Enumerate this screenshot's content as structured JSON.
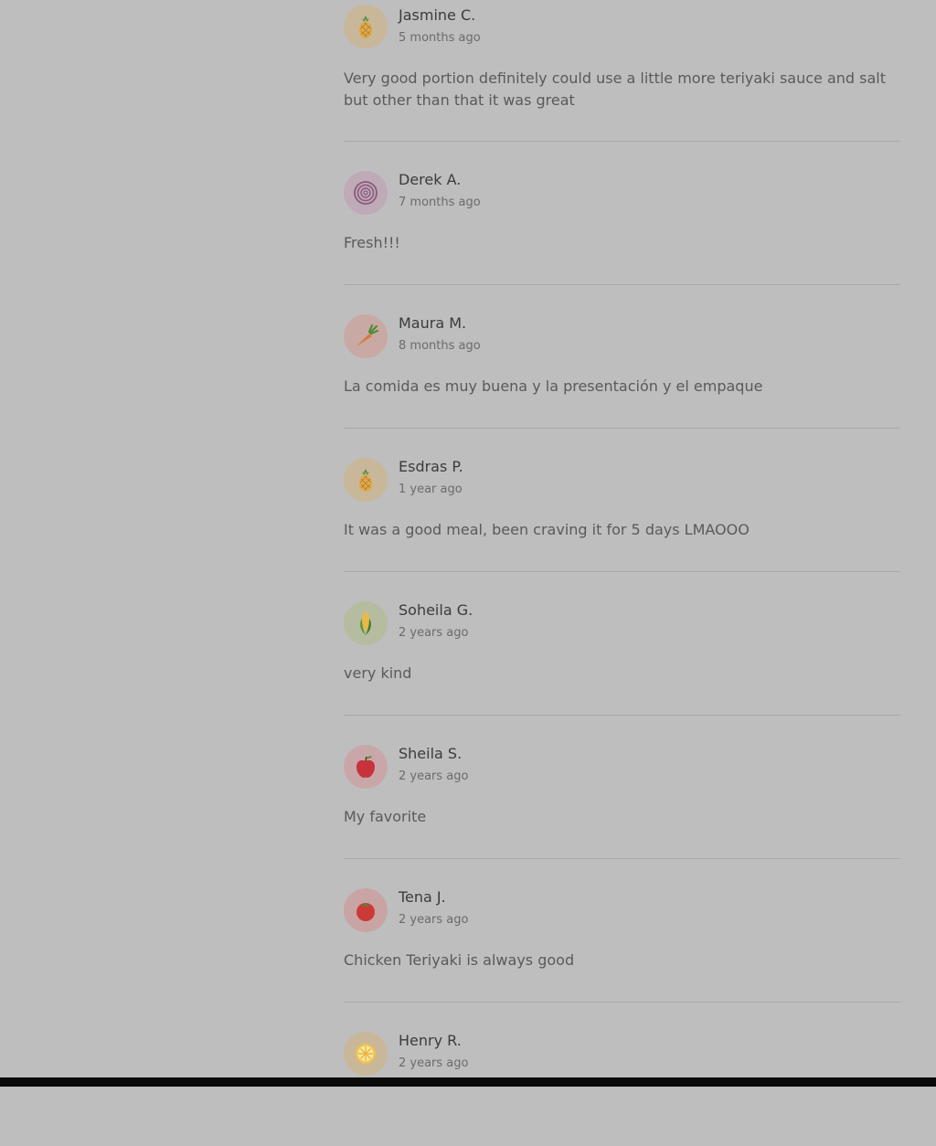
{
  "reviews": [
    {
      "name": "Jasmine C.",
      "time": "5 months ago",
      "text": "Very good portion definitely could use a little more teriyaki sauce and salt but other than that it was great",
      "avatar_icon": "pineapple-icon",
      "avatar_bg": "#c9b79a"
    },
    {
      "name": "Derek A.",
      "time": "7 months ago",
      "text": "Fresh!!!",
      "avatar_icon": "onion-icon",
      "avatar_bg": "#bfaab8"
    },
    {
      "name": "Maura M.",
      "time": "8 months ago",
      "text": "La comida es muy buena y la presentación y el empaque",
      "avatar_icon": "carrot-icon",
      "avatar_bg": "#c9a9a3"
    },
    {
      "name": "Esdras P.",
      "time": "1 year ago",
      "text": "It was a good meal, been craving it for 5 days LMAOOO",
      "avatar_icon": "pineapple-icon",
      "avatar_bg": "#c9b79a"
    },
    {
      "name": "Soheila G.",
      "time": "2 years ago",
      "text": "very kind",
      "avatar_icon": "corn-icon",
      "avatar_bg": "#b6bc9f"
    },
    {
      "name": "Sheila S.",
      "time": "2 years ago",
      "text": "My favorite",
      "avatar_icon": "apple-icon",
      "avatar_bg": "#c9a7a9"
    },
    {
      "name": "Tena J.",
      "time": "2 years ago",
      "text": "Chicken Teriyaki is always good",
      "avatar_icon": "tomato-icon",
      "avatar_bg": "#c9a4a4"
    },
    {
      "name": "Henry R.",
      "time": "2 years ago",
      "text": "",
      "avatar_icon": "lemon-icon",
      "avatar_bg": "#c9b79a"
    }
  ]
}
